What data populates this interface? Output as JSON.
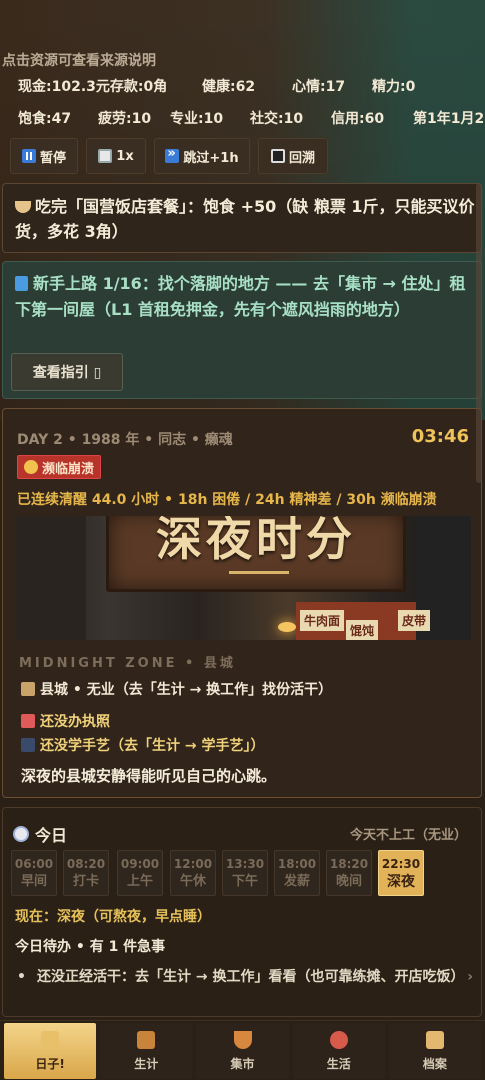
{
  "top_hint": "点击资源可查看来源说明",
  "stats": {
    "row1": [
      "现金:102.3元存款:0角",
      "健康:62",
      "心情:17",
      "精力:0"
    ],
    "row2": [
      "饱食:47",
      "疲劳:10",
      "专业:10",
      "社交:10",
      "信用:60",
      "第1年1月2"
    ]
  },
  "controls": {
    "pause": "暂停",
    "speed": "1x",
    "skip": "跳过+1h",
    "rewind": "回溯"
  },
  "food_card": {
    "text": "吃完「国营饭店套餐」：饱食 +50（缺 粮票 1斤，只能买议价货，多花 3角）",
    "icon": "bowl-icon"
  },
  "guide_card": {
    "text": "新手上路 1/16：找个落脚的地方 —— 去「集市 → 住处」租下第一间屋（L1 首租免押金，先有个遮风挡雨的地方）",
    "button": "查看指引 ▯",
    "icon": "book-icon"
  },
  "day_card": {
    "header": "DAY 2 • 1988 年 • 同志 • 癞魂",
    "time": "03:46",
    "badge": "濒临崩溃",
    "awake": "已连续清醒 44.0 小时 • 18h 困倦 / 24h 精神差 / 30h 濒临崩溃",
    "scene_sign": "深夜时分",
    "scene_stall_1": "牛肉面",
    "scene_stall_2": "馄饨",
    "scene_stall_3": "皮带",
    "zone": "MIDNIGHT ZONE • 县城",
    "location": "县城 • 无业（去「生计 → 换工作」找份活干）",
    "license": "还没办执照",
    "skill": "还没学手艺（去「生计 → 学手艺」）",
    "mood": "深夜的县城安静得能听见自己的心跳。"
  },
  "today": {
    "title": "今日",
    "status": "今天不上工（无业）",
    "slots": [
      {
        "time": "06:00",
        "label": "早间"
      },
      {
        "time": "08:20",
        "label": "打卡"
      },
      {
        "time": "09:00",
        "label": "上午"
      },
      {
        "time": "12:00",
        "label": "午休"
      },
      {
        "time": "13:30",
        "label": "下午"
      },
      {
        "time": "18:00",
        "label": "发薪"
      },
      {
        "time": "18:20",
        "label": "晚间"
      },
      {
        "time": "22:30",
        "label": "深夜"
      }
    ],
    "now": "现在：深夜（可熬夜，早点睡）",
    "todo_header": "今日待办 • 有 1 件急事",
    "todo_item": "还没正经活干：去「生计 → 换工作」看看（也可靠练摊、开店吃饭）",
    "chevron": "›"
  },
  "nav": [
    {
      "label": "日子!",
      "icon": "house-icon",
      "color": "#e8c06a"
    },
    {
      "label": "生计",
      "icon": "briefcase-icon",
      "color": "#c8843a"
    },
    {
      "label": "集市",
      "icon": "basket-icon",
      "color": "#d8873e"
    },
    {
      "label": "生活",
      "icon": "family-icon",
      "color": "#d85a4a"
    },
    {
      "label": "档案",
      "icon": "scroll-icon",
      "color": "#e2b870"
    }
  ]
}
